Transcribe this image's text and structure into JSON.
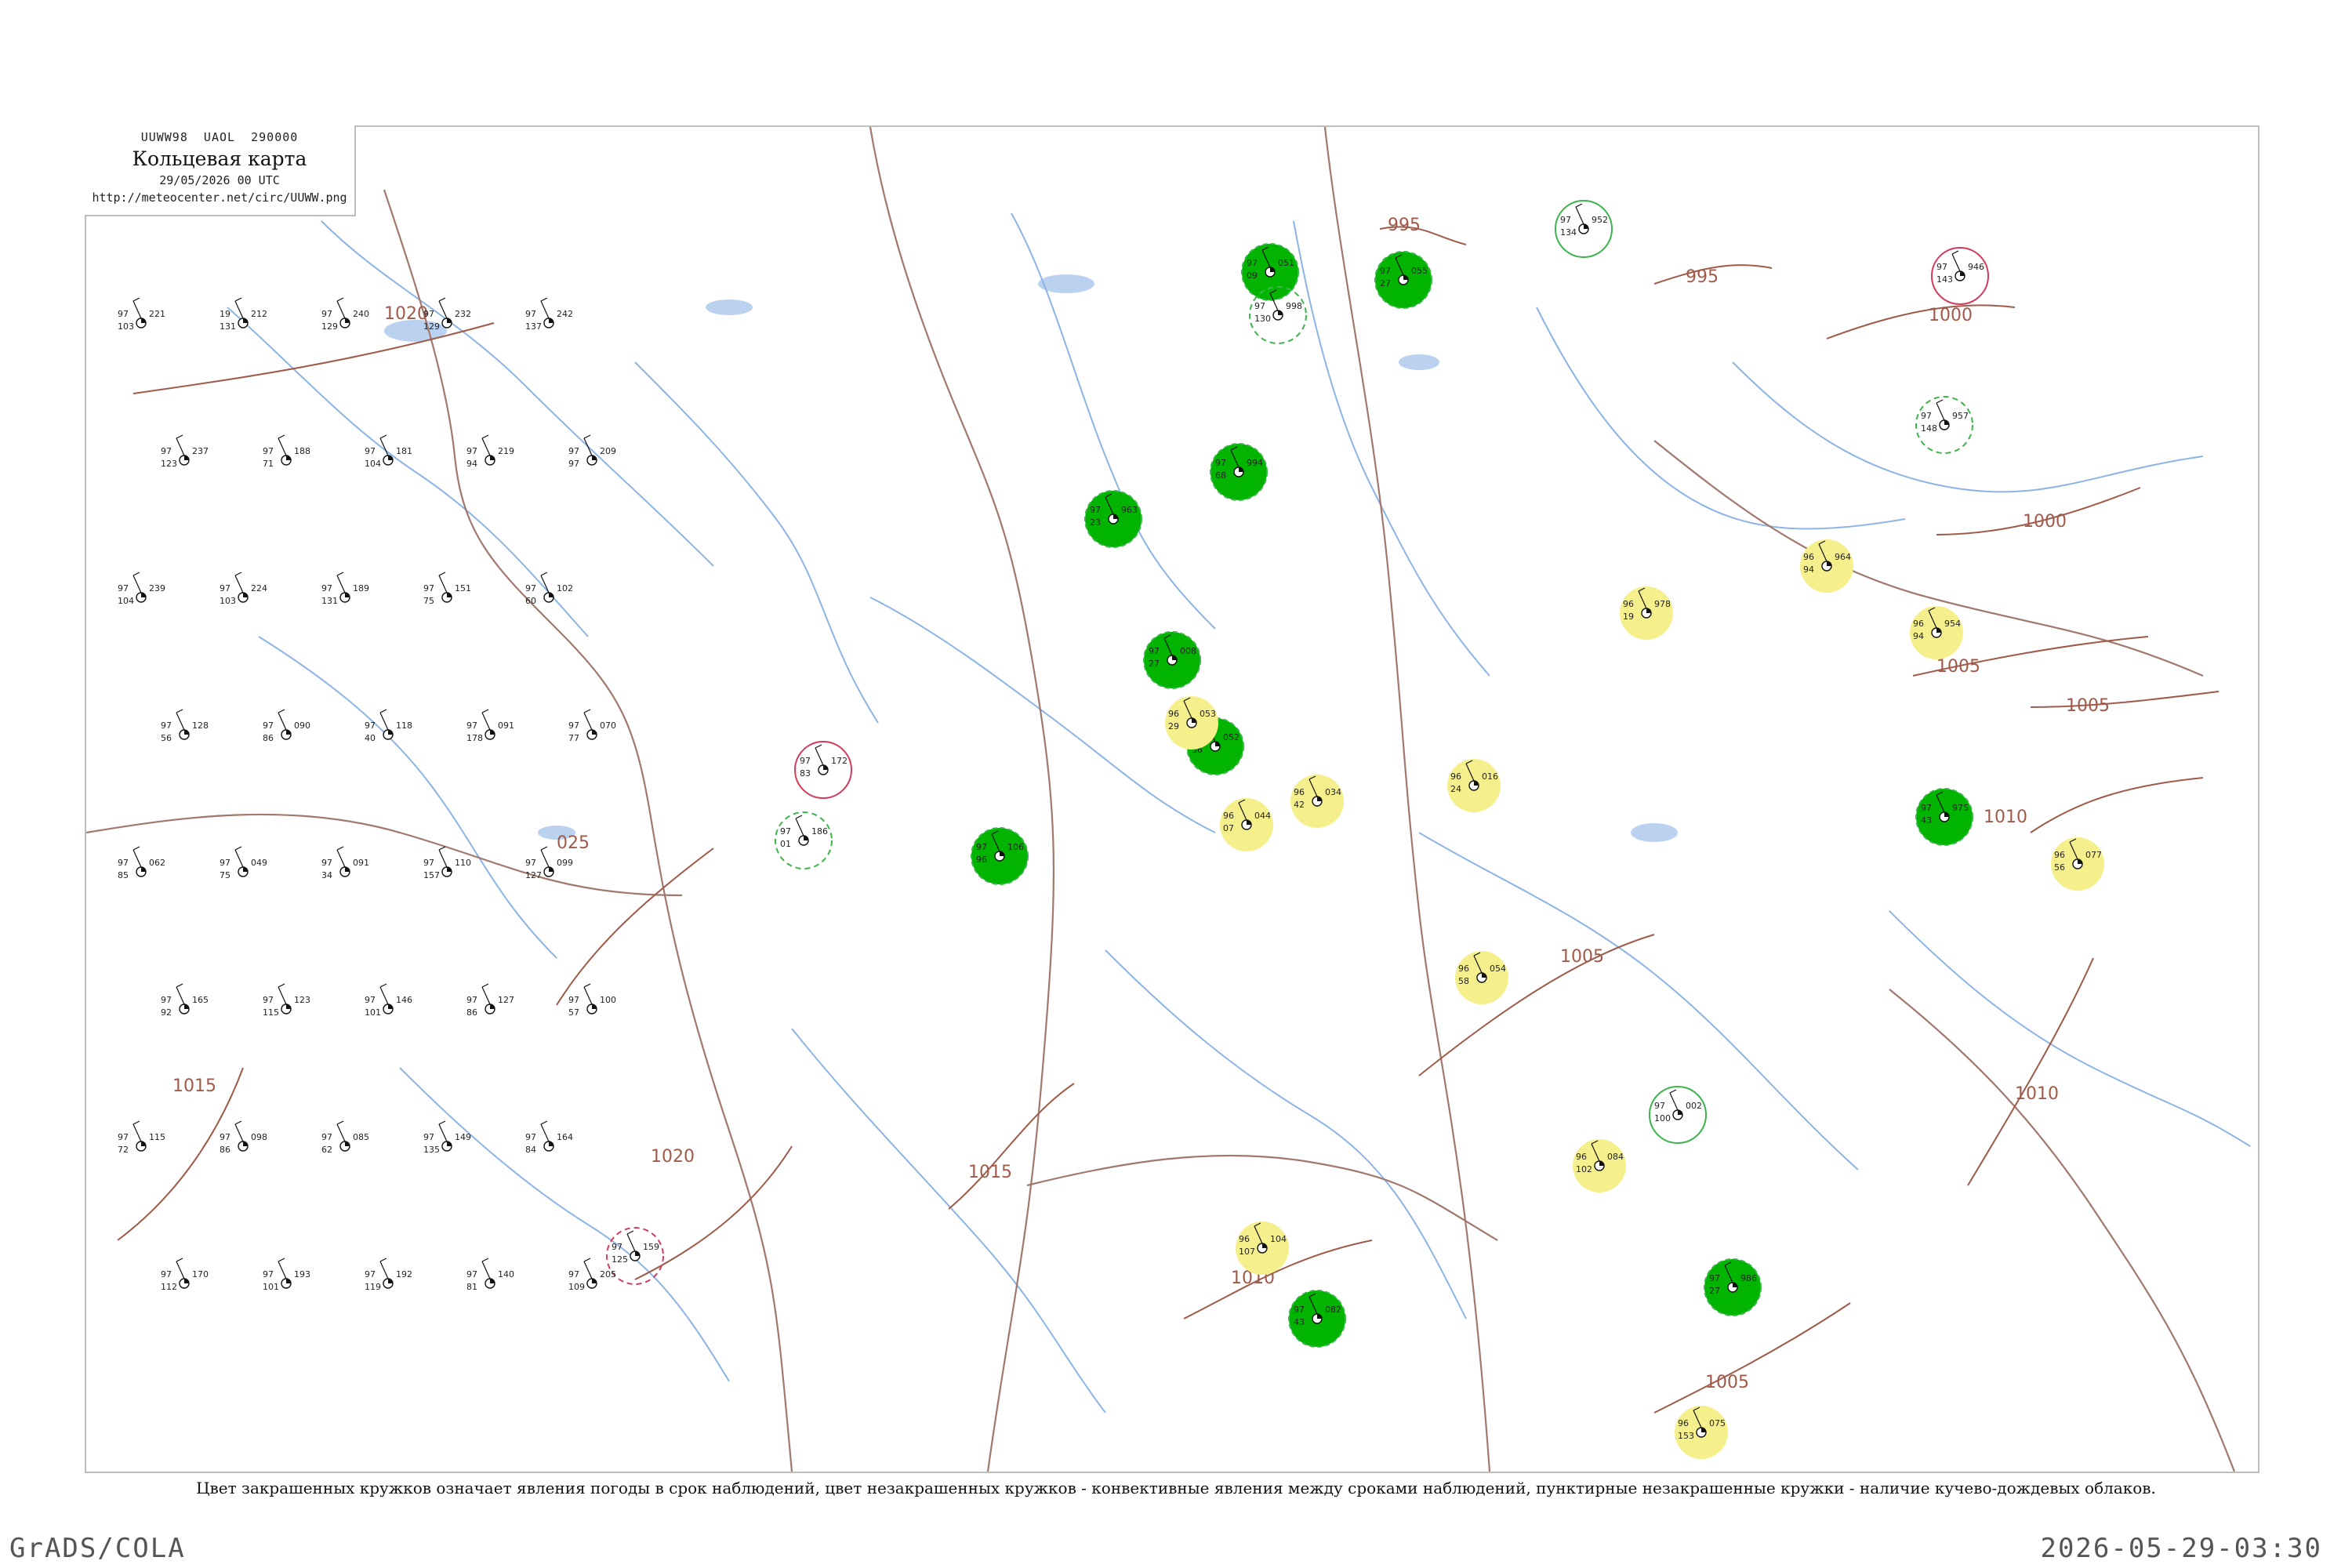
{
  "header": {
    "code_line": "UUWW98  UAOL  290000",
    "title": "Кольцевая карта",
    "date": "29/05/2026 00 UTC",
    "url": "http://meteocenter.net/circ/UUWW.png"
  },
  "caption": "Цвет закрашенных кружков означает явления погоды в срок наблюдений, цвет незакрашенных кружков - конвективные явления между сроками наблюдений, пунктирные незакрашенные кружки - наличие кучево-дождевых облаков.",
  "footer": {
    "left": "GrADS/COLA",
    "right": "2026-05-29-03:30"
  },
  "colors": {
    "precip_fill": "#00b400",
    "shower_fill": "#f5f08c",
    "convective_ring_green": "#3cb44b",
    "thunder_ring_red": "#d23c5a",
    "river": "#8cb4e6",
    "border": "#a0786e",
    "isobar": "#a05a4a"
  },
  "isobars": [
    {
      "value": "1020",
      "label": "1020"
    },
    {
      "value": "1025",
      "label": "025"
    },
    {
      "value": "1020",
      "label": "1020"
    },
    {
      "value": "1015",
      "label": "1015"
    },
    {
      "value": "1015",
      "label": "1015"
    },
    {
      "value": "1010",
      "label": "1010"
    },
    {
      "value": "1005",
      "label": "1005"
    },
    {
      "value": "1005",
      "label": "1005"
    },
    {
      "value": "1010",
      "label": "1010"
    },
    {
      "value": "1005",
      "label": "1005"
    },
    {
      "value": "1010",
      "label": "1010"
    },
    {
      "value": "1000",
      "label": "1000"
    },
    {
      "value": "1000",
      "label": "1000"
    },
    {
      "value": "995",
      "label": "995"
    },
    {
      "value": "995",
      "label": "995"
    },
    {
      "value": "1005",
      "label": "1005"
    }
  ],
  "stations_filled_green": [
    {
      "p": "051",
      "t": "97",
      "d": "09"
    },
    {
      "p": "055",
      "t": "97",
      "d": "27"
    },
    {
      "p": "994",
      "t": "97",
      "d": "68"
    },
    {
      "p": "963",
      "t": "97",
      "d": "23"
    },
    {
      "p": "008",
      "t": "97",
      "d": "27"
    },
    {
      "p": "052",
      "t": "97",
      "d": "36"
    },
    {
      "p": "106",
      "t": "97",
      "d": "96"
    },
    {
      "p": "082",
      "t": "97",
      "d": "43"
    },
    {
      "p": "986",
      "t": "97",
      "d": "27"
    },
    {
      "p": "975",
      "t": "97",
      "d": "43"
    }
  ],
  "stations_filled_yellow": [
    {
      "p": "053",
      "t": "96",
      "d": "29"
    },
    {
      "p": "044",
      "t": "96",
      "d": "07"
    },
    {
      "p": "034",
      "t": "96",
      "d": "42"
    },
    {
      "p": "016",
      "t": "96",
      "d": "24"
    },
    {
      "p": "964",
      "t": "96",
      "d": "94"
    },
    {
      "p": "954",
      "t": "96",
      "d": "94"
    },
    {
      "p": "978",
      "t": "96",
      "d": "19"
    },
    {
      "p": "077",
      "t": "96",
      "d": "56"
    },
    {
      "p": "084",
      "t": "96",
      "d": "102"
    },
    {
      "p": "104",
      "t": "96",
      "d": "107"
    },
    {
      "p": "075",
      "t": "96",
      "d": "153"
    },
    {
      "p": "054",
      "t": "96",
      "d": "58"
    }
  ],
  "stations_ring_only": [
    {
      "p": "172",
      "t": "97",
      "d": "83"
    },
    {
      "p": "186",
      "t": "97",
      "d": "01"
    },
    {
      "p": "002",
      "t": "97",
      "d": "100"
    },
    {
      "p": "159",
      "t": "97",
      "d": "125"
    },
    {
      "p": "952",
      "t": "97",
      "d": "134"
    },
    {
      "p": "957",
      "t": "97",
      "d": "148"
    },
    {
      "p": "946",
      "t": "97",
      "d": "143"
    },
    {
      "p": "998",
      "t": "97",
      "d": "130"
    }
  ],
  "stations_plain": [
    {
      "p": "221",
      "t": "97",
      "d": "103"
    },
    {
      "p": "212",
      "t": "19",
      "d": "131"
    },
    {
      "p": "240",
      "t": "97",
      "d": "129"
    },
    {
      "p": "232",
      "t": "97",
      "d": "129"
    },
    {
      "p": "242",
      "t": "97",
      "d": "137"
    },
    {
      "p": "237",
      "t": "97",
      "d": "123"
    },
    {
      "p": "188",
      "t": "97",
      "d": "71"
    },
    {
      "p": "181",
      "t": "97",
      "d": "104"
    },
    {
      "p": "219",
      "t": "97",
      "d": "94"
    },
    {
      "p": "209",
      "t": "97",
      "d": "97"
    },
    {
      "p": "239",
      "t": "97",
      "d": "104"
    },
    {
      "p": "224",
      "t": "97",
      "d": "103"
    },
    {
      "p": "189",
      "t": "97",
      "d": "131"
    },
    {
      "p": "151",
      "t": "97",
      "d": "75"
    },
    {
      "p": "102",
      "t": "97",
      "d": "60"
    },
    {
      "p": "128",
      "t": "97",
      "d": "56"
    },
    {
      "p": "090",
      "t": "97",
      "d": "86"
    },
    {
      "p": "118",
      "t": "97",
      "d": "40"
    },
    {
      "p": "091",
      "t": "97",
      "d": "178"
    },
    {
      "p": "070",
      "t": "97",
      "d": "77"
    },
    {
      "p": "062",
      "t": "97",
      "d": "85"
    },
    {
      "p": "049",
      "t": "97",
      "d": "75"
    },
    {
      "p": "091",
      "t": "97",
      "d": "34"
    },
    {
      "p": "110",
      "t": "97",
      "d": "157"
    },
    {
      "p": "099",
      "t": "97",
      "d": "127"
    },
    {
      "p": "165",
      "t": "97",
      "d": "92"
    },
    {
      "p": "123",
      "t": "97",
      "d": "115"
    },
    {
      "p": "146",
      "t": "97",
      "d": "101"
    },
    {
      "p": "127",
      "t": "97",
      "d": "86"
    },
    {
      "p": "100",
      "t": "97",
      "d": "57"
    },
    {
      "p": "115",
      "t": "97",
      "d": "72"
    },
    {
      "p": "098",
      "t": "97",
      "d": "86"
    },
    {
      "p": "085",
      "t": "97",
      "d": "62"
    },
    {
      "p": "149",
      "t": "97",
      "d": "135"
    },
    {
      "p": "164",
      "t": "97",
      "d": "84"
    },
    {
      "p": "170",
      "t": "97",
      "d": "112"
    },
    {
      "p": "193",
      "t": "97",
      "d": "101"
    },
    {
      "p": "192",
      "t": "97",
      "d": "119"
    },
    {
      "p": "140",
      "t": "97",
      "d": "81"
    },
    {
      "p": "205",
      "t": "97",
      "d": "109"
    }
  ]
}
